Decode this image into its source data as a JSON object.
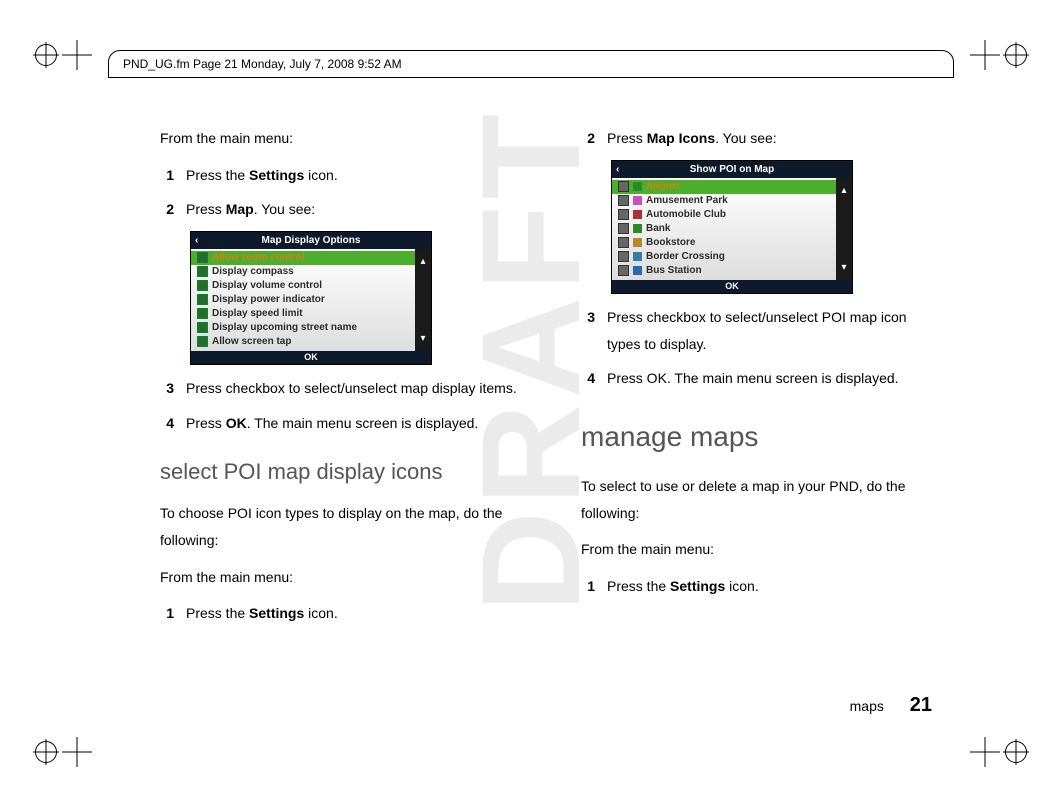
{
  "header": {
    "framemaker_line": "PND_UG.fm  Page 21  Monday, July 7, 2008  9:52 AM"
  },
  "watermark": "DRAFT",
  "left_column": {
    "intro": "From the main menu:",
    "steps_a": [
      {
        "n": "1",
        "pre": "Press the ",
        "bold": "Settings",
        "post": " icon."
      },
      {
        "n": "2",
        "pre": "Press ",
        "bold": "Map",
        "post": ". You see:"
      }
    ],
    "screenshot_a": {
      "title": "Map Display Options",
      "ok": "OK",
      "items": [
        {
          "label": "Allow zoom control",
          "highlight": true
        },
        {
          "label": "Display compass"
        },
        {
          "label": "Display volume control"
        },
        {
          "label": "Display power indicator"
        },
        {
          "label": "Display speed limit"
        },
        {
          "label": "Display upcoming street name"
        },
        {
          "label": "Allow screen tap"
        }
      ]
    },
    "steps_b": [
      {
        "n": "3",
        "text": "Press checkbox to select/unselect map display items."
      },
      {
        "n": "4",
        "pre": "Press ",
        "bold": "OK",
        "post": ". The main menu screen is displayed."
      }
    ],
    "heading": "select POI map display icons",
    "para": "To choose POI icon types to display on the map, do the following:",
    "intro2": "From the main menu:",
    "steps_c": [
      {
        "n": "1",
        "pre": "Press the ",
        "bold": "Settings",
        "post": " icon."
      }
    ]
  },
  "right_column": {
    "steps_a": [
      {
        "n": "2",
        "pre": "Press ",
        "bold": "Map Icons",
        "post": ". You see:"
      }
    ],
    "screenshot_b": {
      "title": "Show POI on Map",
      "ok": "OK",
      "items": [
        {
          "label": "Airport",
          "color": "#2a8a2a",
          "highlight": true
        },
        {
          "label": "Amusement Park",
          "color": "#c94fc9"
        },
        {
          "label": "Automobile Club",
          "color": "#b03030"
        },
        {
          "label": "Bank",
          "color": "#2a8a2a"
        },
        {
          "label": "Bookstore",
          "color": "#b58a2a"
        },
        {
          "label": "Border Crossing",
          "color": "#3a7aaa"
        },
        {
          "label": "Bus Station",
          "color": "#2a6aaa"
        }
      ]
    },
    "steps_b": [
      {
        "n": "3",
        "text": "Press checkbox to select/unselect POI map icon types to display."
      },
      {
        "n": "4",
        "text": "Press OK. The main menu screen is displayed."
      }
    ],
    "heading": "manage maps",
    "para": "To select to use or delete a map in your PND, do the following:",
    "intro": "From the main menu:",
    "steps_c": [
      {
        "n": "1",
        "pre": "Press the ",
        "bold": "Settings",
        "post": " icon."
      }
    ]
  },
  "footer": {
    "section": "maps",
    "page": "21"
  }
}
